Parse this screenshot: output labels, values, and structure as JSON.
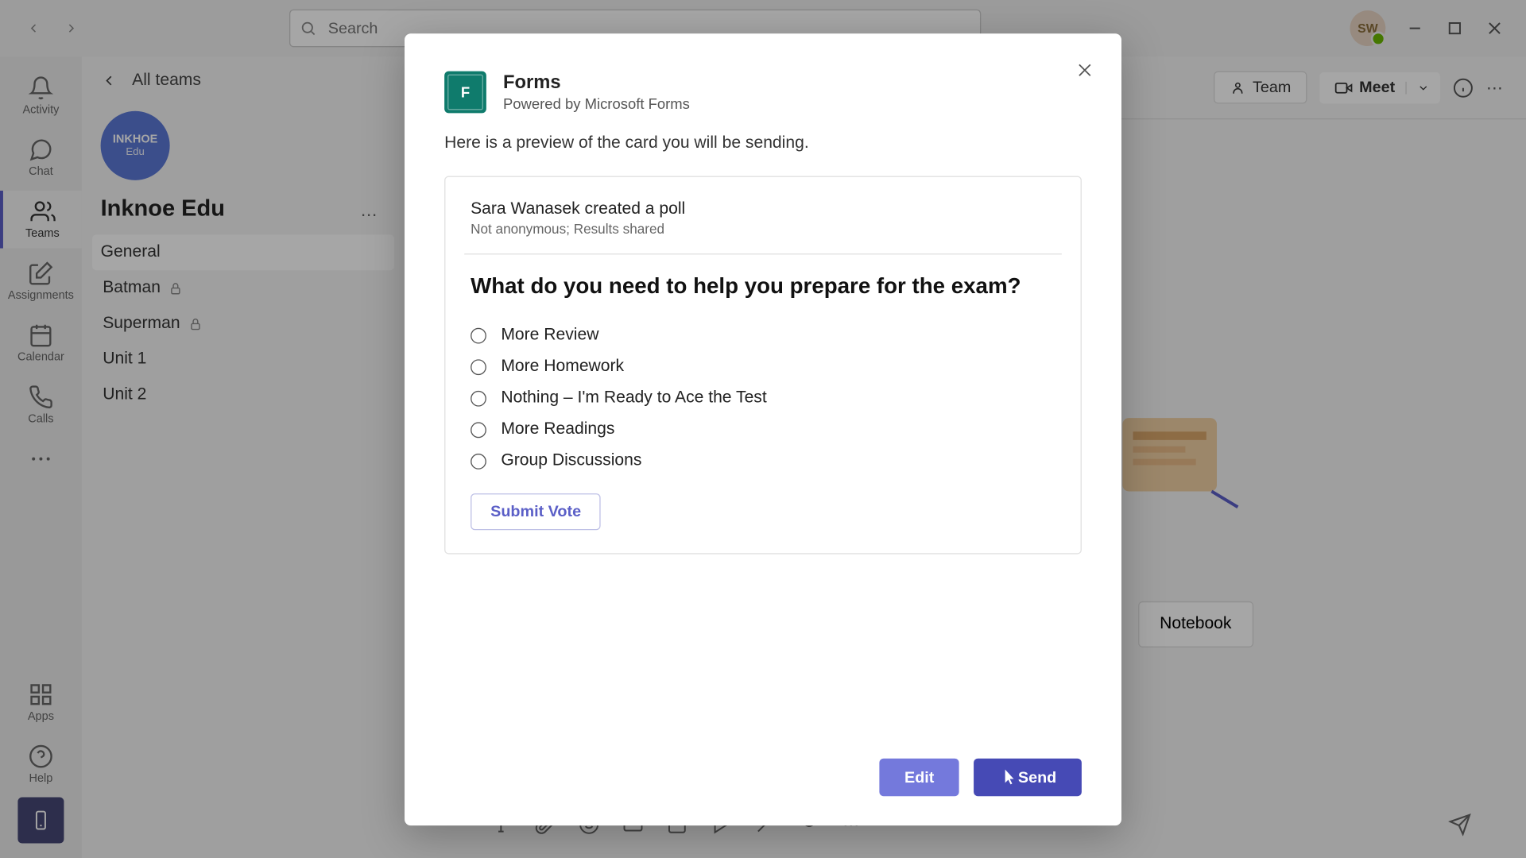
{
  "titlebar": {
    "search_placeholder": "Search",
    "avatar_initials": "SW"
  },
  "rail": {
    "items": [
      {
        "label": "Activity"
      },
      {
        "label": "Chat"
      },
      {
        "label": "Teams"
      },
      {
        "label": "Assignments"
      },
      {
        "label": "Calendar"
      },
      {
        "label": "Calls"
      },
      {
        "label": "Apps"
      },
      {
        "label": "Help"
      }
    ]
  },
  "sidebar": {
    "back_label": "All teams",
    "team_logo_top": "INKHOE",
    "team_logo_bottom": "Edu",
    "team_name": "Inknoe Edu",
    "channels": [
      {
        "label": "General",
        "locked": false,
        "selected": true
      },
      {
        "label": "Batman",
        "locked": true,
        "selected": false
      },
      {
        "label": "Superman",
        "locked": true,
        "selected": false
      },
      {
        "label": "Unit 1",
        "locked": false,
        "selected": false
      },
      {
        "label": "Unit 2",
        "locked": false,
        "selected": false
      }
    ]
  },
  "header": {
    "team_label": "Team",
    "meet_label": "Meet",
    "notebook_label": "Notebook"
  },
  "modal": {
    "app_name": "Forms",
    "app_sub": "Powered by Microsoft Forms",
    "desc": "Here is a preview of the card you will be sending.",
    "poll": {
      "author": "Sara Wanasek created a poll",
      "meta": "Not anonymous; Results shared",
      "question": "What do you need to help you prepare for the exam?",
      "options": [
        "More Review",
        "More Homework",
        "Nothing – I'm Ready to Ace the Test",
        "More Readings",
        "Group Discussions"
      ],
      "submit_label": "Submit Vote"
    },
    "edit_label": "Edit",
    "send_label": "Send"
  }
}
